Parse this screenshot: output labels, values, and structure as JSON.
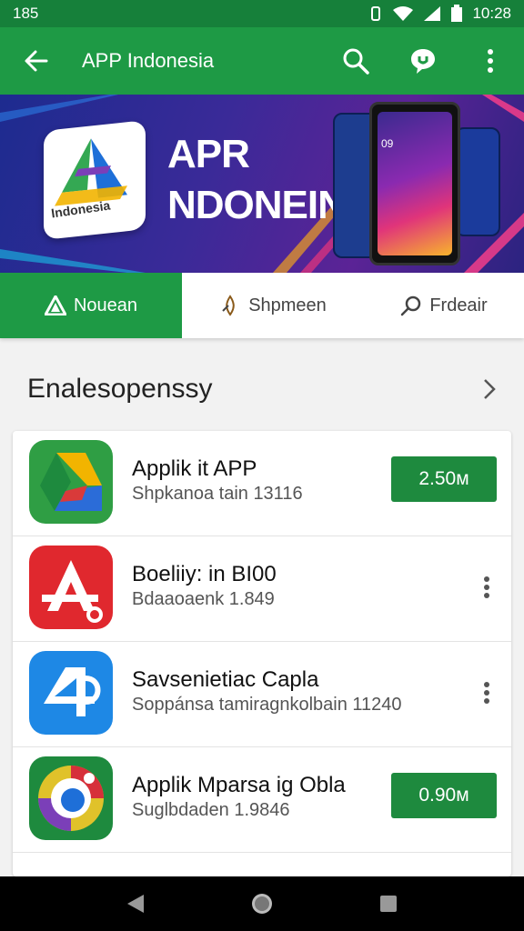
{
  "status_bar": {
    "time": "185",
    "clock": "10:28"
  },
  "app_bar": {
    "title": "APP Indonesia"
  },
  "banner": {
    "logo_label": "Indonesia",
    "headline_line1": "APR",
    "headline_line2": "NDONEIN",
    "phone_clock": "09"
  },
  "tabs": [
    {
      "label": "Nouean",
      "icon": "triangle-logo-icon",
      "active": true
    },
    {
      "label": "Shpmeen",
      "icon": "spark-icon",
      "active": false
    },
    {
      "label": "Frdeair",
      "icon": "search-icon",
      "active": false
    }
  ],
  "section": {
    "title": "Enalesopenssy"
  },
  "apps": [
    {
      "name": "Applik it APP",
      "sub": "Shpkanoa tain 13116",
      "price": "2.50м",
      "has_price": true
    },
    {
      "name": "Boeliiy: in BI00",
      "sub": "Bdaaoaenk 1.849",
      "price": "",
      "has_price": false
    },
    {
      "name": "Savsenietiac Capla",
      "sub": "Soppánsa tamiragnkolbain 11240",
      "price": "",
      "has_price": false
    },
    {
      "name": "Applik Mparsa ig Obla",
      "sub": "Suglbdaden 1.9846",
      "price": "0.90м",
      "has_price": true
    }
  ],
  "colors": {
    "primary": "#1e9a45",
    "status": "#16803a",
    "button": "#1e8a3e"
  }
}
